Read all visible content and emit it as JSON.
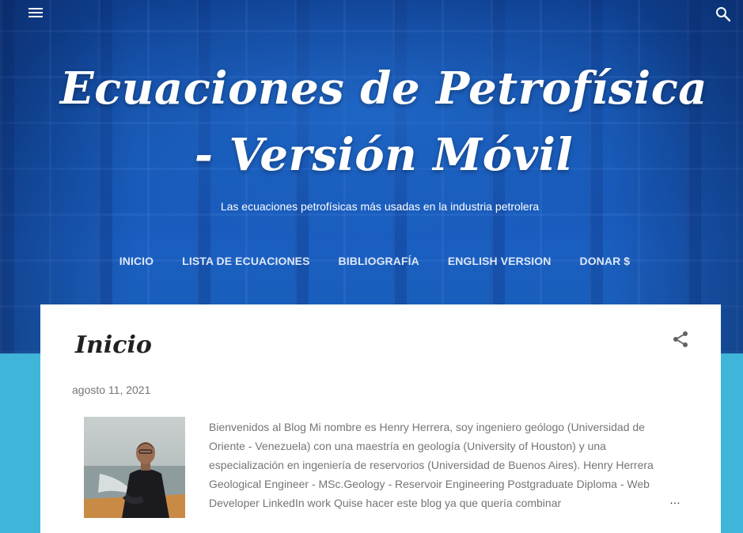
{
  "header": {
    "title": "Ecuaciones de Petrofísica - Versión Móvil",
    "subtitle": "Las ecuaciones petrofísicas más usadas en la industria petrolera",
    "menu_icon": "menu-icon",
    "search_icon": "search-icon"
  },
  "nav": {
    "items": [
      {
        "label": "INICIO"
      },
      {
        "label": "LISTA DE ECUACIONES"
      },
      {
        "label": "BIBLIOGRAFÍA"
      },
      {
        "label": "ENGLISH VERSION"
      },
      {
        "label": "DONAR $"
      }
    ]
  },
  "post": {
    "title": "Inicio",
    "date": "agosto 11, 2021",
    "share_icon": "share-icon",
    "snippet": "Bienvenidos al Blog Mi nombre es Henry Herrera, soy ingeniero geólogo (Universidad de Oriente - Venezuela) con una maestría en geología (University of Houston) y una especialización en ingeniería de reservorios (Universidad de Buenos Aires). Henry Herrera Geological Engineer - MSc.Geology - Reservoir Engineering Postgraduate Diploma - Web Developer LinkedIn work Quise hacer este blog ya que quería combinar",
    "more": "…"
  },
  "colors": {
    "page_background": "#3fb5d9",
    "hero_blue": "#1656b3",
    "card_background": "#ffffff",
    "title_text": "#212121",
    "meta_text": "#757575"
  }
}
